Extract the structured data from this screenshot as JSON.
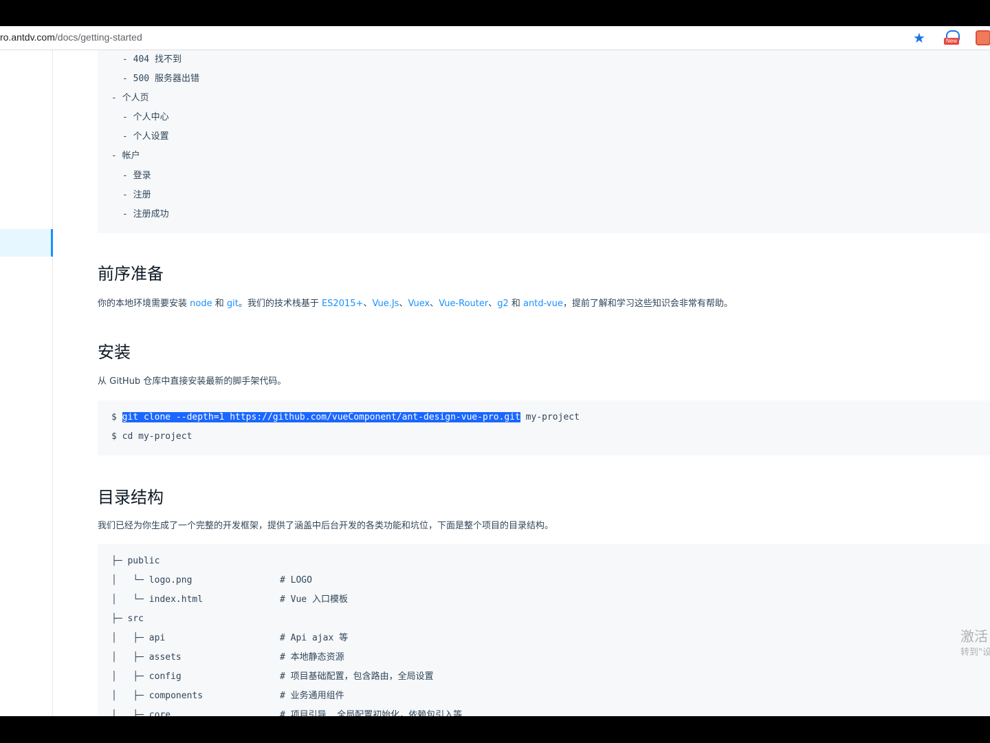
{
  "browser": {
    "url_host": "pro.antdv.com",
    "url_path": "/docs/getting-started",
    "url_visible_prefix": "ro.antdv.com",
    "new_badge": "New"
  },
  "menu_tree": [
    {
      "text": "- 404 找不到"
    },
    {
      "text": "- 500 服务器出错"
    },
    {
      "text": "- 个人页"
    },
    {
      "text": "- 个人中心"
    },
    {
      "text": "- 个人设置"
    },
    {
      "text": "- 帐户"
    },
    {
      "text": "- 登录"
    },
    {
      "text": "- 注册"
    },
    {
      "text": "- 注册成功"
    }
  ],
  "prereq": {
    "heading": "前序准备",
    "text_1": "你的本地环境需要安装 ",
    "link_node": "node",
    "text_2": " 和 ",
    "link_git": "git",
    "text_3": "。我们的技术栈基于 ",
    "link_es": "ES2015+",
    "sep_1": "、",
    "link_vuejs": "Vue.Js",
    "sep_2": "、",
    "link_vuex": "Vuex",
    "sep_3": "、",
    "link_router": "Vue-Router",
    "sep_4": "、",
    "link_g2": "g2",
    "text_4": " 和 ",
    "link_antdvue": "antd-vue",
    "text_5": "，提前了解和学习这些知识会非常有帮助。"
  },
  "install": {
    "heading": "安装",
    "description": "从 GitHub 仓库中直接安装最新的脚手架代码。",
    "prompt": "$ ",
    "cmd_selected": "git clone --depth=1 https://github.com/vueComponent/ant-design-vue-pro.git",
    "cmd_rest": " my-project",
    "line2": "$ cd my-project"
  },
  "structure": {
    "heading": "目录结构",
    "description": "我们已经为你生成了一个完整的开发框架，提供了涵盖中后台开发的各类功能和坑位，下面是整个项目的目录结构。",
    "rows": [
      {
        "path": "├─ public",
        "comment": ""
      },
      {
        "path": "│   └─ logo.png",
        "comment": "# LOGO"
      },
      {
        "path": "│   └─ index.html",
        "comment": "# Vue 入口模板"
      },
      {
        "path": "├─ src",
        "comment": ""
      },
      {
        "path": "│   ├─ api",
        "comment": "# Api ajax 等"
      },
      {
        "path": "│   ├─ assets",
        "comment": "# 本地静态资源"
      },
      {
        "path": "│   ├─ config",
        "comment": "# 项目基础配置，包含路由，全局设置"
      },
      {
        "path": "│   ├─ components",
        "comment": "# 业务通用组件"
      },
      {
        "path": "│   ├─ core",
        "comment": "# 项目引导, 全局配置初始化，依赖包引入等"
      }
    ]
  },
  "watermark": {
    "line1": "激活",
    "line2": "转到\"设"
  }
}
